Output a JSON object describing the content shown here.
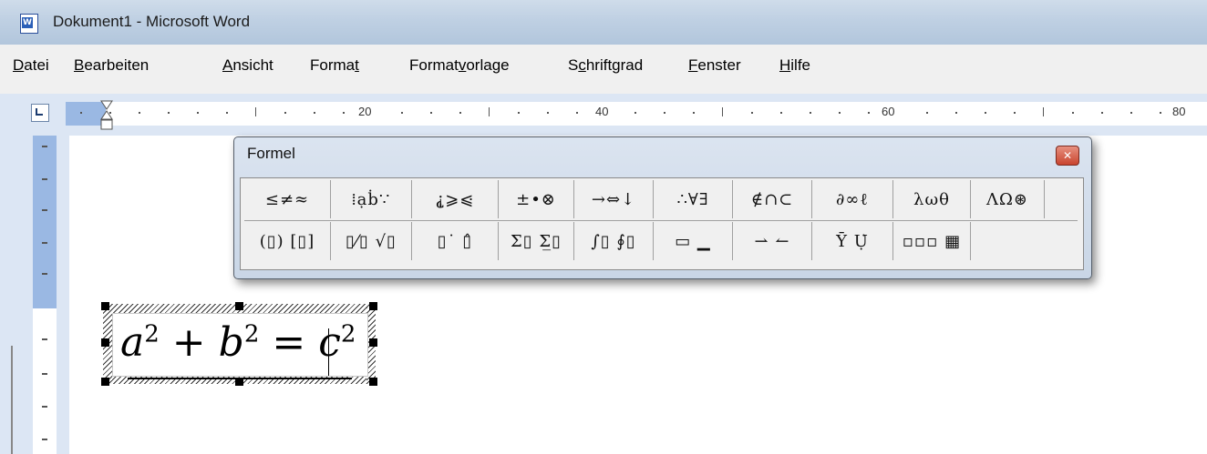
{
  "window": {
    "title": "Dokument1 - Microsoft Word",
    "icon": "word-document-icon"
  },
  "menubar": {
    "items": [
      {
        "prefix": "",
        "key": "D",
        "rest": "atei"
      },
      {
        "prefix": "",
        "key": "B",
        "rest": "earbeiten"
      },
      {
        "prefix": "",
        "key": "A",
        "rest": "nsicht"
      },
      {
        "prefix": "Forma",
        "key": "t",
        "rest": ""
      },
      {
        "prefix": "Format",
        "key": "v",
        "rest": "orlage"
      },
      {
        "prefix": "S",
        "key": "c",
        "rest": "hriftgrad"
      },
      {
        "prefix": "",
        "key": "F",
        "rest": "enster"
      },
      {
        "prefix": "",
        "key": "H",
        "rest": "ilfe"
      }
    ]
  },
  "ruler": {
    "labels": [
      "20",
      "40",
      "60",
      "80"
    ]
  },
  "formula_toolbar": {
    "title": "Formel",
    "close_icon": "close-icon",
    "row1": [
      "≤≠≈",
      "⁞ạḃ∵",
      "⸘⩾⩿",
      "±•⊗",
      "→⇔↓",
      "∴∀∃",
      "∉∩⊂",
      "∂∞ℓ",
      "λωθ",
      "ΛΩ⊛"
    ],
    "row2": [
      "(▯) [▯]",
      "▯⁄▯ √▯",
      "▯˙ ▯̂",
      "Σ▯ Σ̲▯",
      "∫▯ ∮▯",
      "▭ ▁",
      "⇀ ↼",
      "Ῡ Ụ̇",
      "▫▫▫ ▦"
    ]
  },
  "equation": {
    "a": "a",
    "b": "b",
    "c": "c",
    "exp": "2",
    "plus": "+",
    "equals": "="
  }
}
